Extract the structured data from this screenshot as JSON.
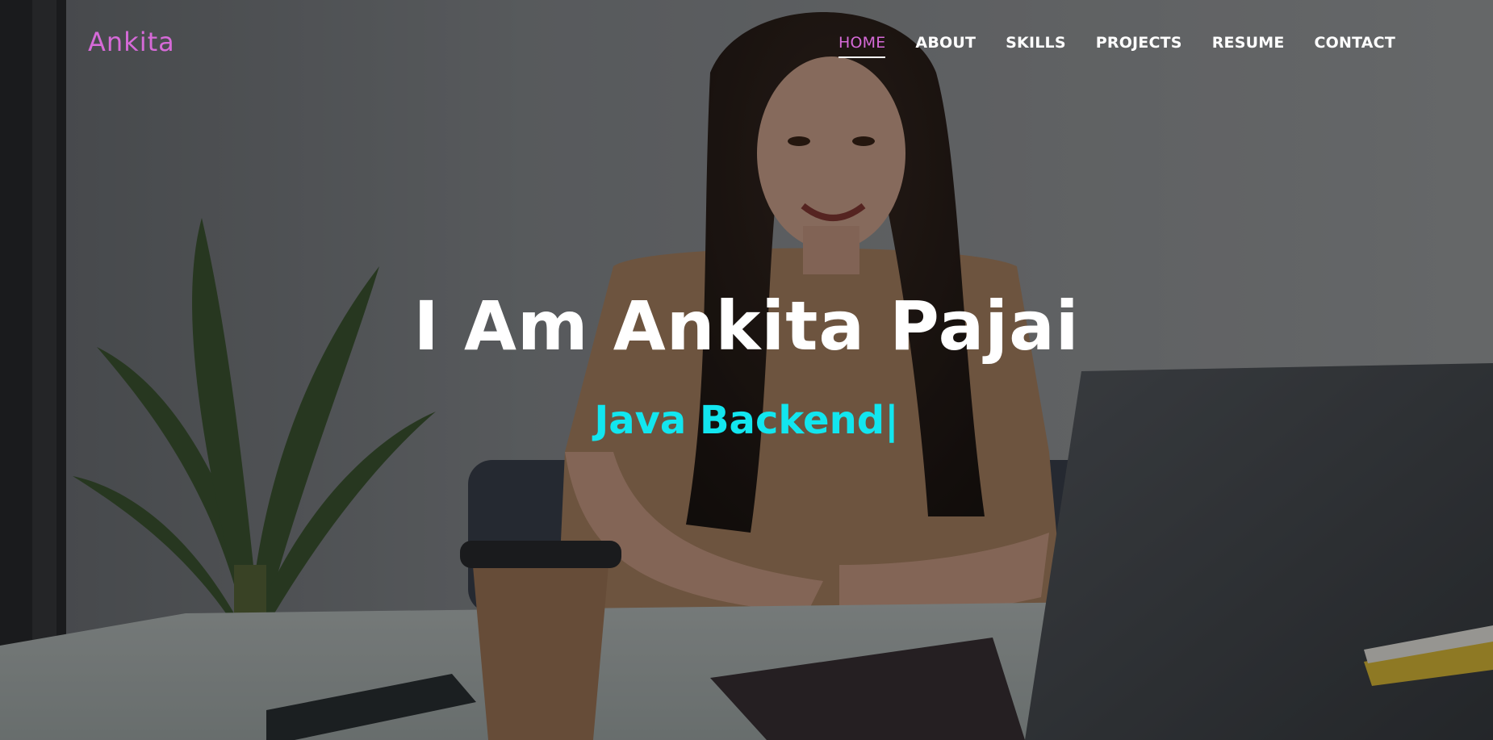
{
  "brand": {
    "name": "Ankita",
    "color": "#d66ad8"
  },
  "nav": {
    "items": [
      {
        "label": "HOME",
        "active": true
      },
      {
        "label": "ABOUT",
        "active": false
      },
      {
        "label": "SKILLS",
        "active": false
      },
      {
        "label": "PROJECTS",
        "active": false
      },
      {
        "label": "RESUME",
        "active": false
      },
      {
        "label": "CONTACT",
        "active": false
      }
    ],
    "active_color": "#d66ad8"
  },
  "hero": {
    "headline": "I Am Ankita Pajai",
    "typed_text": "Java Backend",
    "cursor": "|",
    "typed_color": "#12e6ef"
  },
  "background": {
    "description_icon": "woman-at-laptop-photo"
  }
}
